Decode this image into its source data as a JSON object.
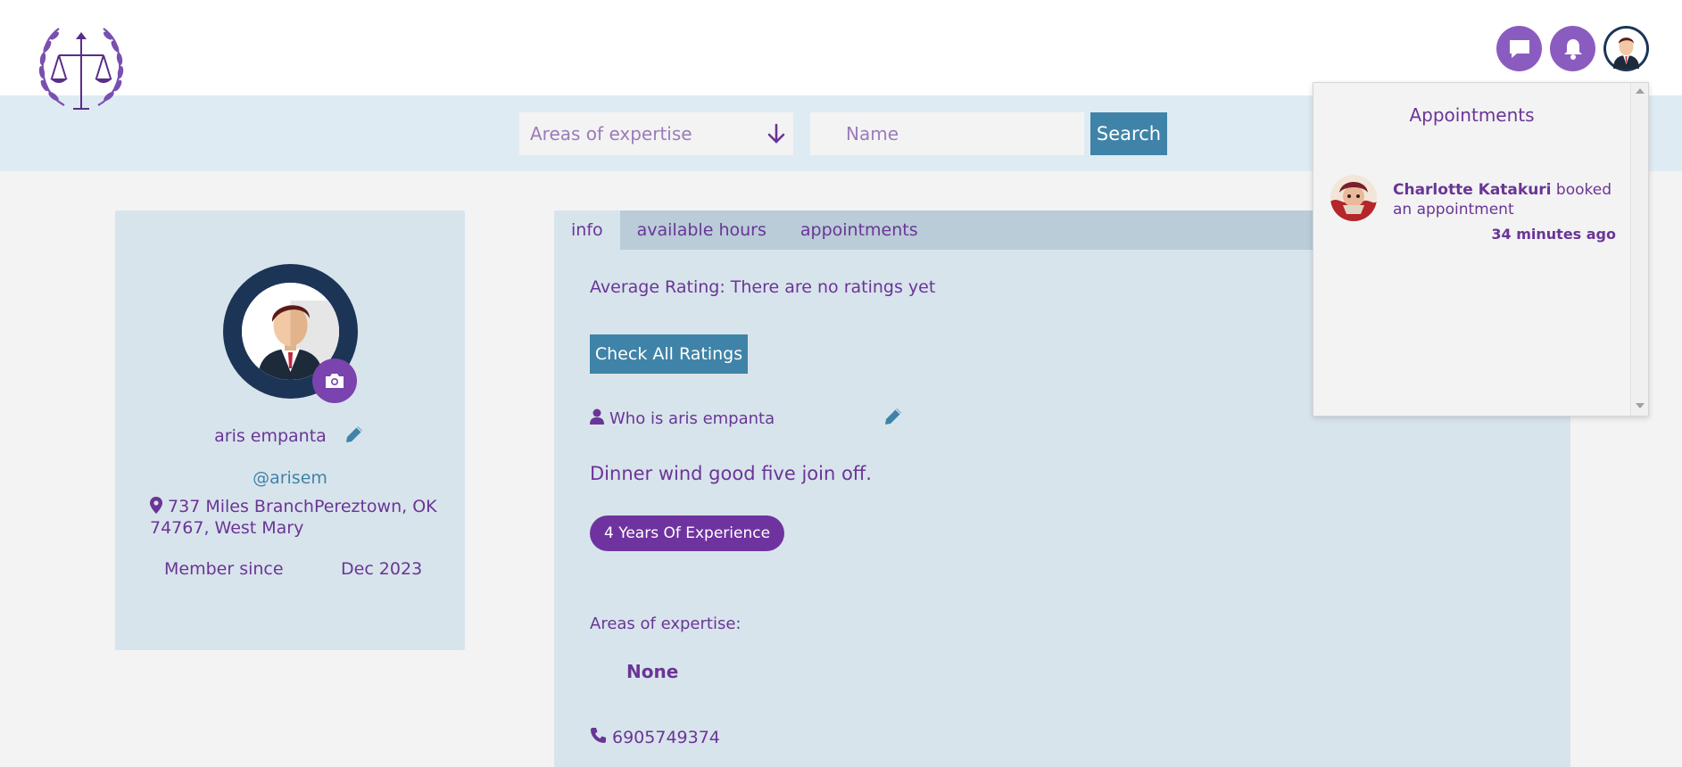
{
  "header": {
    "logo_name": "scales-of-justice-logo"
  },
  "top_icons": [
    "chat-icon",
    "bell-icon",
    "user-avatar"
  ],
  "search": {
    "expertise_placeholder": "Areas of expertise",
    "name_placeholder": "Name",
    "button_label": "Search"
  },
  "profile": {
    "name": "aris empanta",
    "handle": "@arisem",
    "address": "737 Miles BranchPereztown, OK 74767, West Mary",
    "member_since_label": "Member since",
    "member_since_value": "Dec 2023"
  },
  "tabs": [
    {
      "label": "info",
      "active": true
    },
    {
      "label": "available hours",
      "active": false
    },
    {
      "label": "appointments",
      "active": false
    }
  ],
  "info": {
    "average_rating": "Average Rating: There are no ratings yet",
    "check_ratings_label": "Check All Ratings",
    "who_is": "Who is aris empanta",
    "bio": "Dinner wind good five join off.",
    "experience_badge": "4 Years Of Experience",
    "areas_label": "Areas of expertise:",
    "areas_value": "None",
    "phone": "6905749374"
  },
  "appointments_dropdown": {
    "title": "Appointments",
    "notifications": [
      {
        "name": "Charlotte Katakuri",
        "message": "booked an appointment",
        "time": "34 minutes ago"
      }
    ]
  },
  "colors": {
    "purple": "#6a3596",
    "accent_blue": "#3f83a8",
    "navy": "#1c3556",
    "panel_bg": "#d8e4ec",
    "search_band": "#deebf3"
  }
}
